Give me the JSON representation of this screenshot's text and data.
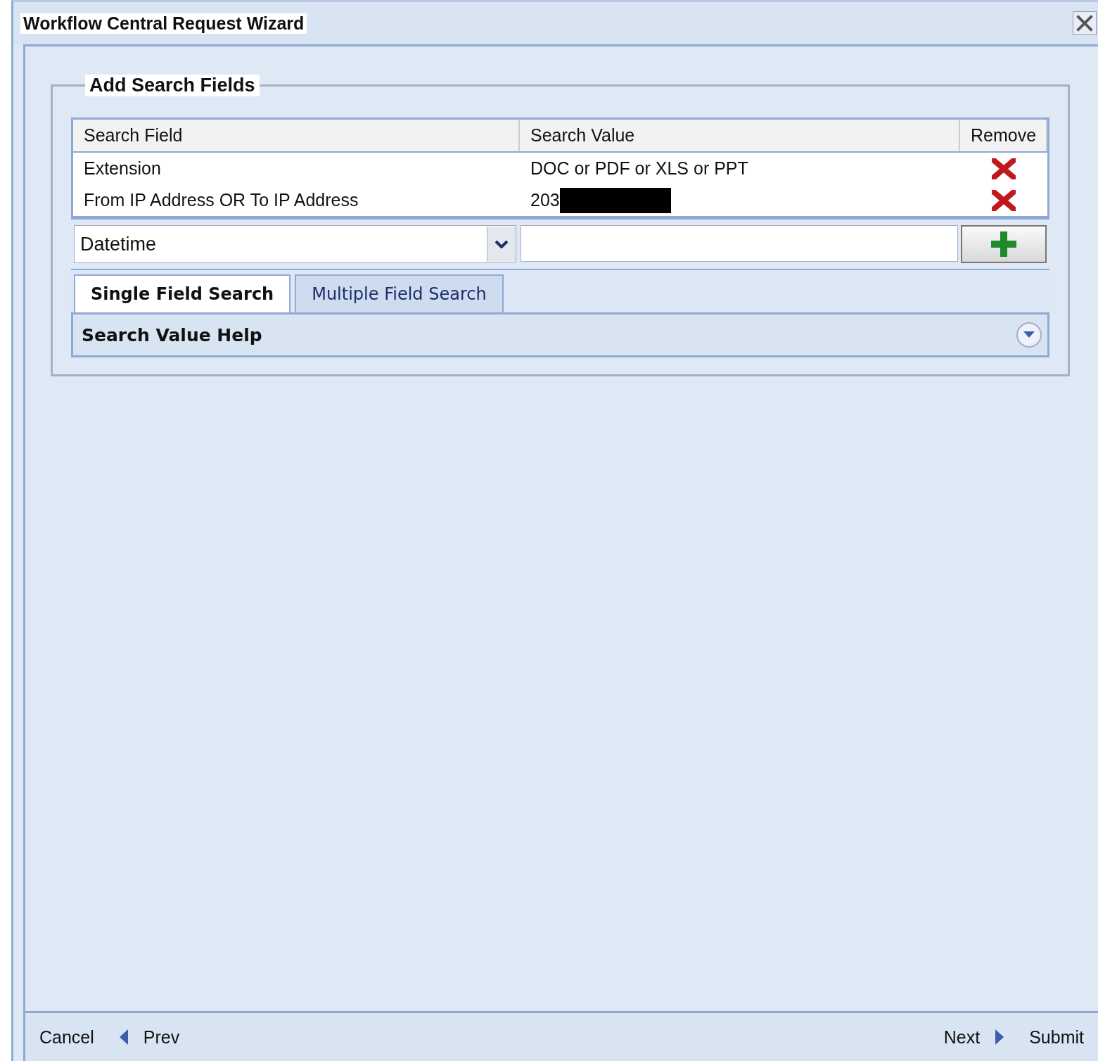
{
  "window": {
    "title": "Workflow Central Request Wizard"
  },
  "section": {
    "title": "Add Search Fields"
  },
  "table": {
    "columns": [
      "Search Field",
      "Search Value",
      "Remove"
    ],
    "rows": [
      {
        "field": "Extension",
        "value": "DOC or PDF or XLS or PPT",
        "redacted": false
      },
      {
        "field": "From IP Address OR To IP Address",
        "value": "203",
        "redacted": true
      }
    ]
  },
  "new_row": {
    "field": "Datetime"
  },
  "tabs": [
    {
      "label": "Single Field Search",
      "selected": true
    },
    {
      "label": "Multiple Field Search",
      "selected": false
    }
  ],
  "help": {
    "title": "Search Value Help",
    "expanded": false
  },
  "footer": {
    "left_buttons": [
      {
        "label": "Cancel",
        "kind": "plain"
      },
      {
        "label": "Prev",
        "kind": "back"
      }
    ],
    "right_buttons": [
      {
        "label": "Next",
        "kind": "forward"
      },
      {
        "label": "Submit",
        "kind": "plain"
      }
    ]
  }
}
